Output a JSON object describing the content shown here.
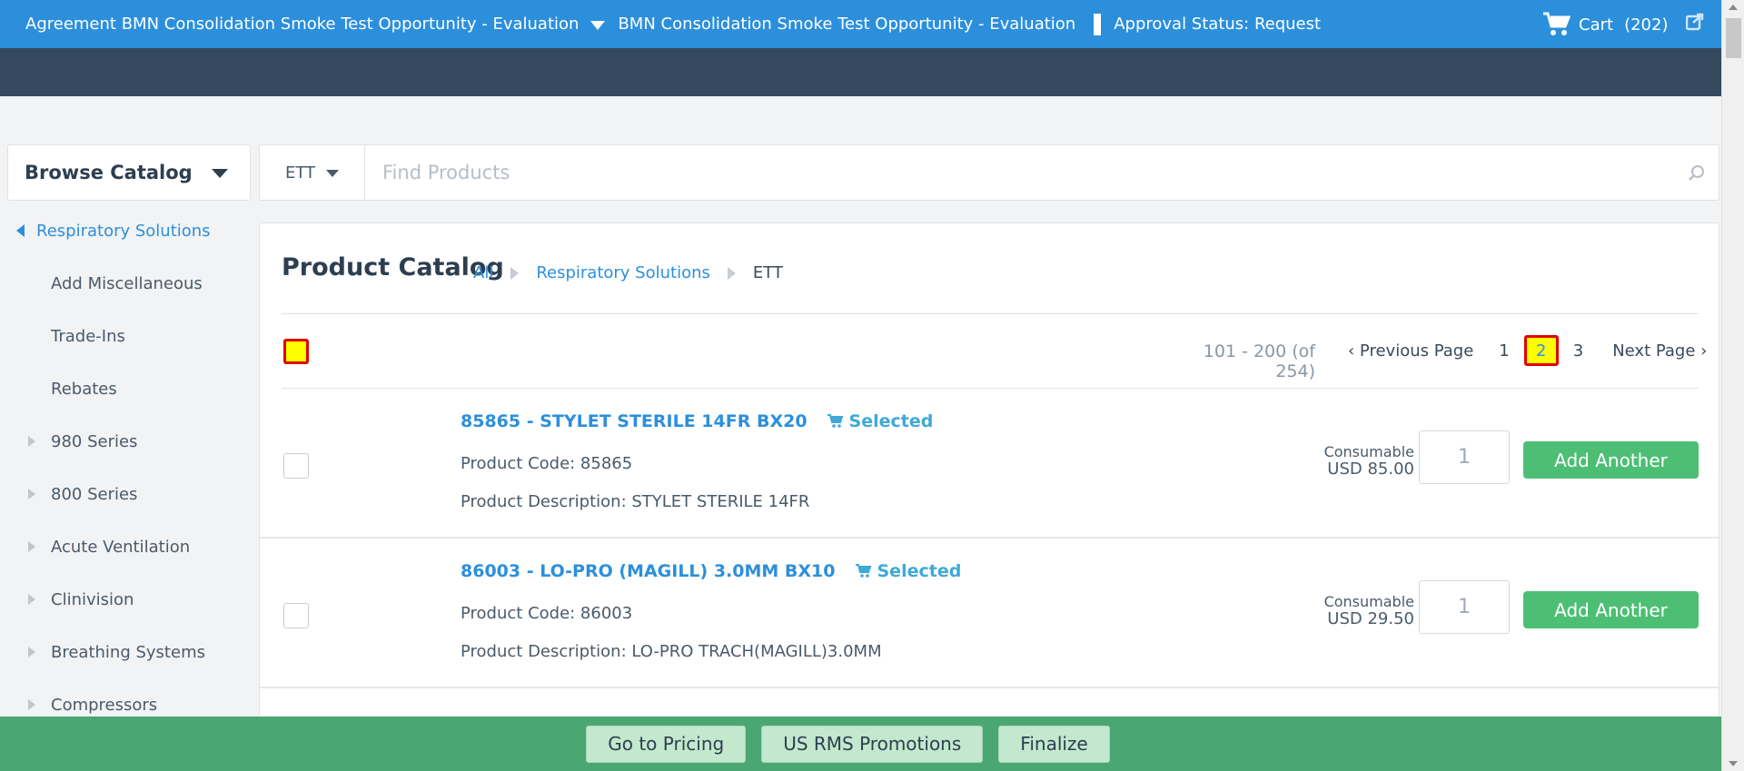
{
  "header": {
    "agreement": "Agreement BMN Consolidation Smoke Test Opportunity - Evaluation",
    "opportunity": "BMN Consolidation Smoke Test Opportunity - Evaluation",
    "approval_status": "Approval Status: Request",
    "cart_label": "Cart",
    "cart_count": "(202)"
  },
  "sidebar": {
    "browse_label": "Browse Catalog",
    "parent": "Respiratory Solutions",
    "items": [
      {
        "label": "Add Miscellaneous",
        "expandable": false
      },
      {
        "label": "Trade-Ins",
        "expandable": false
      },
      {
        "label": "Rebates",
        "expandable": false
      },
      {
        "label": "980 Series",
        "expandable": true
      },
      {
        "label": "800 Series",
        "expandable": true
      },
      {
        "label": "Acute Ventilation",
        "expandable": true
      },
      {
        "label": "Clinivision",
        "expandable": true
      },
      {
        "label": "Breathing Systems",
        "expandable": true
      },
      {
        "label": "Compressors",
        "expandable": true
      }
    ]
  },
  "search": {
    "filter": "ETT",
    "placeholder": "Find Products"
  },
  "catalog": {
    "title": "Product Catalog",
    "breadcrumbs": [
      "All",
      "Respiratory Solutions",
      "ETT"
    ],
    "range": "101 - 200 (of 254)",
    "prev_label": "‹ Previous Page",
    "pages": [
      "1",
      "2",
      "3"
    ],
    "current_page": "2",
    "next_label": "Next Page ›",
    "products": [
      {
        "name": "85865 - STYLET STERILE 14FR BX20",
        "selected_label": "Selected",
        "code": "Product Code: 85865",
        "description": "Product Description: STYLET STERILE 14FR",
        "type": "Consumable",
        "price": "USD 85.00",
        "qty": "1",
        "add_label": "Add Another"
      },
      {
        "name": "86003 - LO-PRO (MAGILL) 3.0MM BX10",
        "selected_label": "Selected",
        "code": "Product Code: 86003",
        "description": "Product Description: LO-PRO TRACH(MAGILL)3.0MM",
        "type": "Consumable",
        "price": "USD 29.50",
        "qty": "1",
        "add_label": "Add Another"
      }
    ]
  },
  "footer": {
    "buttons": [
      "Go to Pricing",
      "US RMS Promotions",
      "Finalize"
    ]
  }
}
